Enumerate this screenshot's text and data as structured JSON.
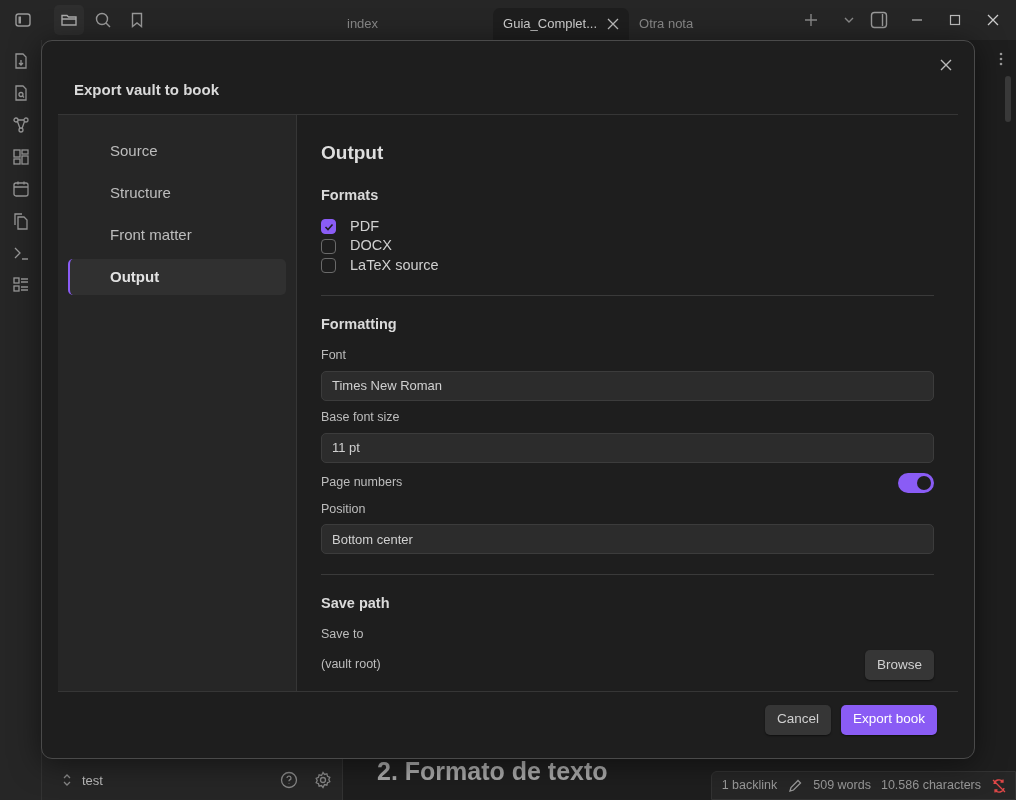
{
  "titlebar": {
    "tabs": [
      {
        "label": "index",
        "selected": false
      },
      {
        "label": "Guia_Complet...",
        "selected": true
      },
      {
        "label": "Otra nota",
        "selected": false
      }
    ]
  },
  "sidebar": {
    "vault_name": "test"
  },
  "editor": {
    "heading": "2. Formato de texto"
  },
  "status_bar": {
    "backlinks": "1 backlink",
    "words": "509 words",
    "characters": "10.586 characters"
  },
  "dialog": {
    "title": "Export vault to book",
    "nav": [
      {
        "label": "Source",
        "selected": false
      },
      {
        "label": "Structure",
        "selected": false
      },
      {
        "label": "Front matter",
        "selected": false
      },
      {
        "label": "Output",
        "selected": true
      }
    ],
    "section_title": "Output",
    "formats": {
      "heading": "Formats",
      "options": [
        {
          "label": "PDF",
          "checked": true
        },
        {
          "label": "DOCX",
          "checked": false
        },
        {
          "label": "LaTeX source",
          "checked": false
        }
      ]
    },
    "formatting": {
      "heading": "Formatting",
      "fields": [
        {
          "kind": "input",
          "label": "Font",
          "value": "Times New Roman"
        },
        {
          "kind": "input",
          "label": "Base font size",
          "value": "11 pt"
        },
        {
          "kind": "toggle",
          "label": "Page numbers",
          "on": true
        },
        {
          "kind": "input",
          "label": "Position",
          "value": "Bottom center"
        }
      ]
    },
    "save_path": {
      "heading": "Save path",
      "label": "Save to",
      "value": "(vault root)",
      "button": "Browse"
    },
    "buttons": [
      {
        "label": "Cancel",
        "kind": "secondary"
      },
      {
        "label": "Export book",
        "kind": "primary"
      }
    ]
  }
}
